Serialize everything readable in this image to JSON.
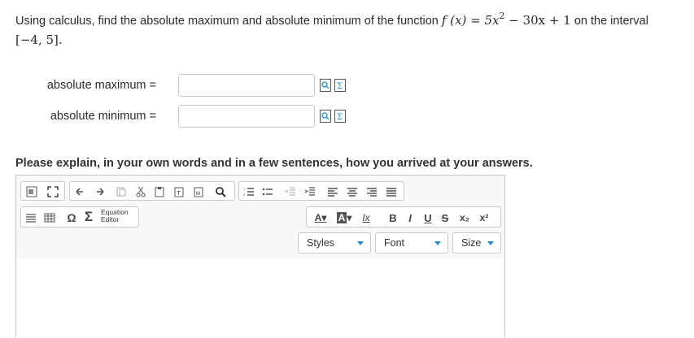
{
  "question": {
    "prefix": "Using calculus, find the absolute maximum and absolute minimum of the function",
    "func_lhs": "f (x) = 5x",
    "exponent": "2",
    "func_rhs": " − 30x + 1",
    "suffix": "on the interval",
    "interval": "[−4, 5]."
  },
  "answers": [
    {
      "label": "absolute maximum =",
      "value": ""
    },
    {
      "label": "absolute minimum =",
      "value": ""
    }
  ],
  "explain_prompt": "Please explain, in your own words and in a few sentences, how you arrived at your answers.",
  "editor": {
    "equation_editor_line1": "Equation",
    "equation_editor_line2": "Editor",
    "styles_label": "Styles",
    "font_label": "Font",
    "size_label": "Size",
    "text_color": "A",
    "bg_color": "A",
    "remove_format": "Ix",
    "bold": "B",
    "italic": "I",
    "underline": "U",
    "strike": "S",
    "subscript": "x₂",
    "superscript": "x²",
    "omega": "Ω",
    "sigma": "Σ",
    "content": ""
  },
  "colors": {
    "accent": "#1a8fd1",
    "border": "#c7c7c7",
    "toolbar_bg": "#f8f8f8"
  }
}
